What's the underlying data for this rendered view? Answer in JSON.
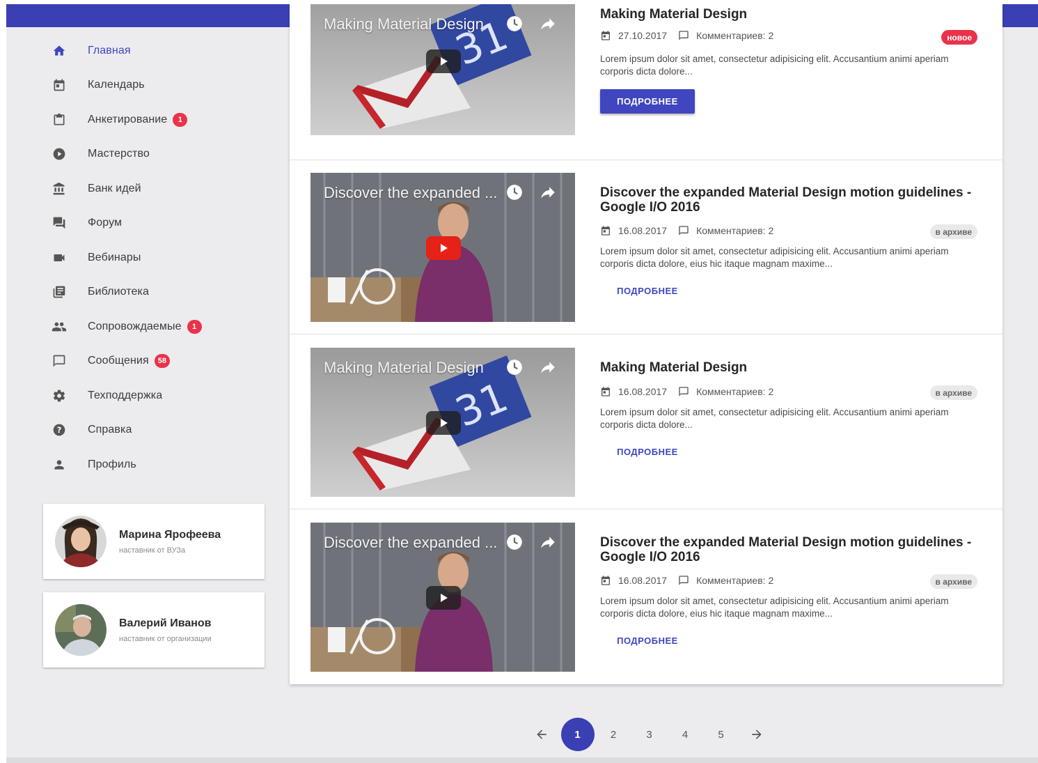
{
  "sidebar": {
    "items": [
      {
        "label": "Главная",
        "icon": "home-icon",
        "active": true,
        "badge": ""
      },
      {
        "label": "Календарь",
        "icon": "calendar-icon",
        "badge": ""
      },
      {
        "label": "Анкетирование",
        "icon": "clipboard-icon",
        "badge": "1"
      },
      {
        "label": "Мастерство",
        "icon": "play-circle-icon",
        "badge": ""
      },
      {
        "label": "Банк идей",
        "icon": "bank-icon",
        "badge": ""
      },
      {
        "label": "Форум",
        "icon": "forum-icon",
        "badge": ""
      },
      {
        "label": "Вебинары",
        "icon": "videocam-icon",
        "badge": ""
      },
      {
        "label": "Библиотека",
        "icon": "library-icon",
        "badge": ""
      },
      {
        "label": "Сопровождаемые",
        "icon": "people-icon",
        "badge": "1"
      },
      {
        "label": "Сообщения",
        "icon": "message-icon",
        "badge": "58"
      },
      {
        "label": "Техподдержка",
        "icon": "gear-icon",
        "badge": ""
      },
      {
        "label": "Справка",
        "icon": "help-icon",
        "badge": ""
      },
      {
        "label": "Профиль",
        "icon": "person-icon",
        "badge": ""
      }
    ]
  },
  "mentors": [
    {
      "name": "Марина Ярофеева",
      "role": "наставник от ВУЗа"
    },
    {
      "name": "Валерий Иванов",
      "role": "наставник от организации"
    }
  ],
  "posts": [
    {
      "thumb_title": "Making Material Design",
      "title": "Making Material Design",
      "date": "27.10.2017",
      "comments": "Комментариев: 2",
      "tag": "новое",
      "excerpt": "Lorem ipsum dolor sit amet, consectetur adipisicing elit. Accusantium animi aperiam corporis dicta dolore...",
      "more": "ПОДРОБНЕЕ"
    },
    {
      "thumb_title": "Discover the expanded ...",
      "title": "Discover the expanded Material Design motion guidelines - Google I/O 2016",
      "date": "16.08.2017",
      "comments": "Комментариев: 2",
      "tag": "в архиве",
      "excerpt": "Lorem ipsum dolor sit amet, consectetur adipisicing elit. Accusantium animi aperiam corporis dicta dolore, eius hic itaque magnam maxime...",
      "more": "ПОДРОБНЕЕ"
    },
    {
      "thumb_title": "Making Material Design",
      "title": "Making Material Design",
      "date": "16.08.2017",
      "comments": "Комментариев: 2",
      "tag": "в архиве",
      "excerpt": "Lorem ipsum dolor sit amet, consectetur adipisicing elit. Accusantium animi aperiam corporis dicta dolore...",
      "more": "ПОДРОБНЕЕ"
    },
    {
      "thumb_title": "Discover the expanded ...",
      "title": "Discover the expanded Material Design motion guidelines - Google I/O 2016",
      "date": "16.08.2017",
      "comments": "Комментариев: 2",
      "tag": "в архиве",
      "excerpt": "Lorem ipsum dolor sit amet, consectetur adipisicing elit. Accusantium animi aperiam corporis dicta dolore, eius hic itaque magnam maxime...",
      "more": "ПОДРОБНЕЕ"
    }
  ],
  "pagination": {
    "prev_icon": "arrow-left-icon",
    "pages": [
      "1",
      "2",
      "3",
      "4",
      "5"
    ],
    "current": "1",
    "next_icon": "arrow-right-icon"
  },
  "colors": {
    "primary": "#3a3fb3",
    "badge": "#e8334a",
    "youtube_red": "#e62117"
  }
}
